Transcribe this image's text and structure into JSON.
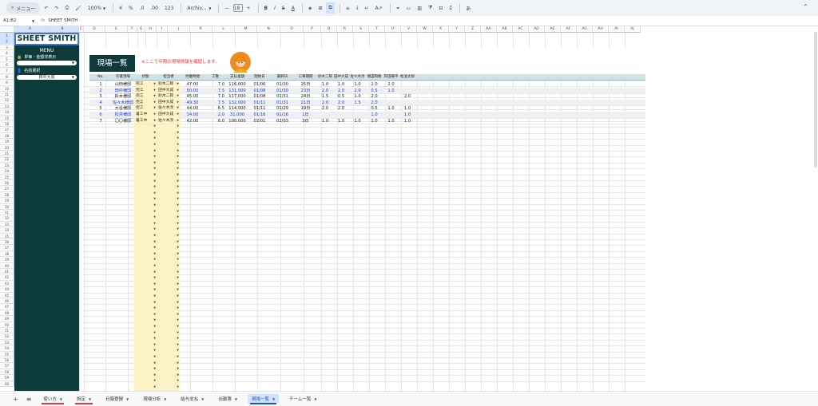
{
  "toolbar": {
    "menu_label": "メニュー",
    "zoom": "100%",
    "currency": "¥",
    "percent": "%",
    "dec_dec": ".0",
    "dec_inc": ".00",
    "number_format": "123",
    "font_name": "Archiv...",
    "font_size": "18"
  },
  "formula_bar": {
    "name_box": "A1:B2",
    "fx": "fx",
    "value": "SHEET SMITH"
  },
  "columns": [
    "A",
    "B",
    "C",
    "D",
    "E",
    "F",
    "G",
    "H",
    "I",
    "J",
    "K",
    "L",
    "M",
    "N",
    "O",
    "P",
    "Q",
    "R",
    "S",
    "T",
    "U",
    "V",
    "W",
    "X",
    "Y",
    "Z",
    "AA",
    "AB",
    "AC",
    "AD",
    "AE",
    "AF",
    "AG",
    "AH",
    "AI",
    "AJ"
  ],
  "sidebar": {
    "logo": "SHEET SMITH",
    "menu_title": "MENU",
    "toggle_label": "単価・金額非表示",
    "name_label": "名前選択",
    "name_value": "田中大成"
  },
  "page": {
    "title": "現場一覧",
    "note": "※ここで年間の現場情報を確認します。"
  },
  "table": {
    "headers": [
      "No.",
      "作業現場",
      "状態",
      "担当者",
      "労働時間",
      "工数",
      "支払金額",
      "開始日",
      "最終日",
      "工事期間",
      "鈴木二郎",
      "田中大成",
      "佐々木淳",
      "増田和樹",
      "岸田陳平",
      "松波太郎"
    ],
    "rows": [
      {
        "no": "1",
        "site": "山田様邸",
        "status": "完工",
        "person": "鈴木二郎",
        "hours": "47:00",
        "kosu": "7.0",
        "amount": "116,000",
        "start": "01/06",
        "end": "01/30",
        "period": "25日",
        "w": [
          "1.0",
          "1.0",
          "1.0",
          "2.0",
          "2.0",
          ""
        ],
        "blue": false,
        "shade": false
      },
      {
        "no": "2",
        "site": "田中様邸",
        "status": "完工",
        "person": "田中大成",
        "hours": "50:00",
        "kosu": "7.5",
        "amount": "131,000",
        "start": "01/08",
        "end": "01/30",
        "period": "23日",
        "w": [
          "2.0",
          "2.0",
          "2.0",
          "0.5",
          "1.0",
          ""
        ],
        "blue": true,
        "shade": true
      },
      {
        "no": "3",
        "site": "鈴木様邸",
        "status": "完工",
        "person": "鈴木二郎",
        "hours": "45:00",
        "kosu": "7.0",
        "amount": "117,000",
        "start": "01/08",
        "end": "01/31",
        "period": "24日",
        "w": [
          "1.5",
          "0.5",
          "1.0",
          "2.0",
          "",
          "2.0"
        ],
        "blue": false,
        "shade": false
      },
      {
        "no": "4",
        "site": "佐々木様邸",
        "status": "完工",
        "person": "田中大成",
        "hours": "49:30",
        "kosu": "7.5",
        "amount": "132,000",
        "start": "01/11",
        "end": "01/31",
        "period": "21日",
        "w": [
          "2.0",
          "2.0",
          "1.5",
          "2.0",
          "",
          ""
        ],
        "blue": true,
        "shade": true
      },
      {
        "no": "5",
        "site": "大谷様邸",
        "status": "完工",
        "person": "佐々木淳",
        "hours": "44:00",
        "kosu": "6.5",
        "amount": "114,000",
        "start": "01/11",
        "end": "01/29",
        "period": "19日",
        "w": [
          "2.0",
          "2.0",
          "",
          "0.5",
          "1.0",
          "1.0"
        ],
        "blue": false,
        "shade": false
      },
      {
        "no": "6",
        "site": "松井様邸",
        "status": "着工中",
        "person": "田中大成",
        "hours": "14:00",
        "kosu": "2.0",
        "amount": "31,000",
        "start": "01/16",
        "end": "01/16",
        "period": "1日",
        "w": [
          "",
          "",
          "",
          "1.0",
          "",
          "1.0"
        ],
        "blue": true,
        "shade": true
      },
      {
        "no": "7",
        "site": "〇〇様邸",
        "status": "着工中",
        "person": "佐々木淳",
        "hours": "42:00",
        "kosu": "6.0",
        "amount": "100,000",
        "start": "02/01",
        "end": "02/03",
        "period": "3日",
        "w": [
          "1.0",
          "1.0",
          "1.0",
          "1.0",
          "1.0",
          "1.0"
        ],
        "blue": false,
        "shade": false
      }
    ]
  },
  "tabs": [
    {
      "label": "使い方",
      "color": "#e53935",
      "active": false
    },
    {
      "label": "設定",
      "color": "#e53935",
      "active": false
    },
    {
      "label": "日報登録",
      "color": "",
      "active": false
    },
    {
      "label": "現場分析",
      "color": "",
      "active": false
    },
    {
      "label": "給与支払",
      "color": "",
      "active": false
    },
    {
      "label": "出勤簿",
      "color": "",
      "active": false
    },
    {
      "label": "現場一覧",
      "color": "#0b57d0",
      "active": true
    },
    {
      "label": "チーム一覧",
      "color": "",
      "active": false
    }
  ]
}
